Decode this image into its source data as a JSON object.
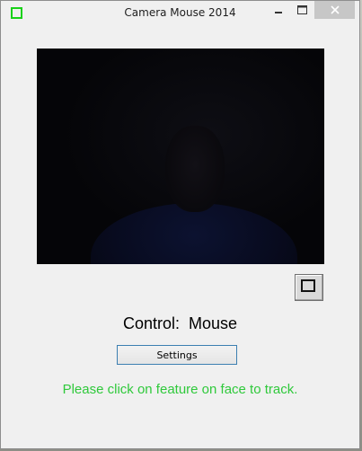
{
  "window": {
    "title": "Camera Mouse 2014",
    "icon": "green-square-app-icon",
    "controls": {
      "minimize_icon": "minimize-icon",
      "maximize_icon": "maximize-icon",
      "close_icon": "close-icon"
    }
  },
  "video": {
    "description_icon": "camera-feed"
  },
  "view_toggle": {
    "icon": "square-icon"
  },
  "control": {
    "text": "Control:  Mouse"
  },
  "settings": {
    "label": "Settings"
  },
  "status": {
    "message": "Please click on feature on face to track.",
    "color": "#2fc93b"
  },
  "colors": {
    "accent_icon": "#19d119",
    "button_border": "#3c7fb1",
    "video_background": "#050508"
  }
}
